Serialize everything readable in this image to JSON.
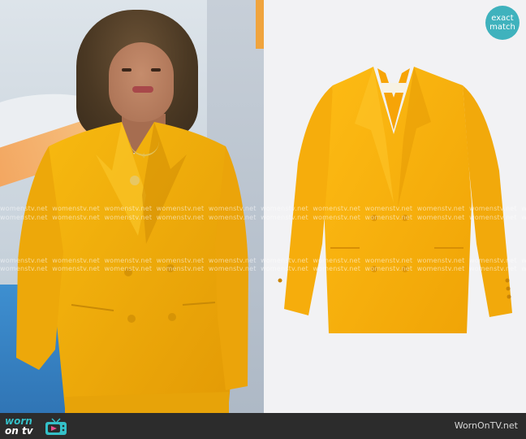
{
  "badge": {
    "line1": "exact",
    "line2": "match"
  },
  "watermark": {
    "text": "womenstv.net"
  },
  "bottom_bar": {
    "logo_line1": "worn",
    "logo_line2": "on tv",
    "site": "WornOnTV.net"
  },
  "colors": {
    "blazer_yellow": "#f5b20e",
    "badge_teal": "#3fb2bd",
    "bar_background": "#2c2c2c",
    "logo_teal": "#34c0c8"
  },
  "icons": [
    "tv-icon"
  ]
}
